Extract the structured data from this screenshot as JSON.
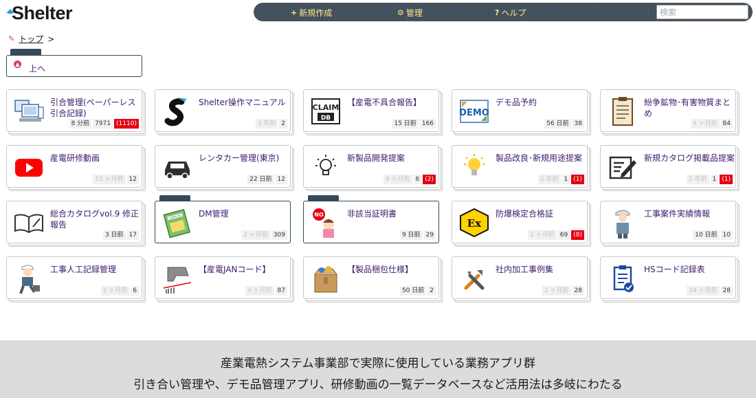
{
  "header": {
    "logo_text": "Shelter",
    "nav": [
      {
        "icon": "+",
        "label": "新規作成"
      },
      {
        "icon": "⚙",
        "label": "管理"
      },
      {
        "icon": "?",
        "label": "ヘルプ"
      }
    ],
    "search_placeholder": "検索"
  },
  "breadcrumb": {
    "home": "トップ",
    "separator": ">"
  },
  "up_folder": {
    "label": "上へ"
  },
  "cards": [
    {
      "title": "引合管理(ペーパーレス引合記録)",
      "time": "8 分前",
      "count": "7971",
      "badge": "(1110)",
      "icon": "computer-icon"
    },
    {
      "title": "Shelter操作マニュアル",
      "time": "3 年前",
      "count": "2",
      "icon": "shelter-logo-icon"
    },
    {
      "title": "【産電不具合報告】",
      "time": "15 日前",
      "count": "166",
      "icon": "claim-db-icon"
    },
    {
      "title": "デモ品予約",
      "time": "56 日前",
      "count": "38",
      "icon": "demo-icon"
    },
    {
      "title": "紛争鉱物･有害物質まとめ",
      "time": "4 ヶ月前",
      "count": "84",
      "icon": "clipboard-icon"
    },
    {
      "title": "産電研修動画",
      "time": "15 ヶ月前",
      "count": "12",
      "icon": "youtube-icon"
    },
    {
      "title": "レンタカー管理(東京)",
      "time": "22 日前",
      "count": "12",
      "icon": "car-icon"
    },
    {
      "title": "新製品開発提案",
      "time": "4 ヶ月前",
      "count": "6",
      "badge": "(2)",
      "icon": "lightbulb-outline-icon"
    },
    {
      "title": "製品改良･新規用途提案",
      "time": "2 年前",
      "count": "1",
      "badge": "(1)",
      "icon": "lightbulb-icon"
    },
    {
      "title": "新規カタログ掲載品提案",
      "time": "2 年前",
      "count": "1",
      "badge": "(1)",
      "icon": "edit-note-icon"
    },
    {
      "title": "総合カタログvol.9 修正報告",
      "time": "3 日前",
      "count": "17",
      "icon": "open-book-icon"
    },
    {
      "title": "DM管理",
      "time": "2 ヶ月前",
      "count": "309",
      "icon": "catalog-icon",
      "folder": true
    },
    {
      "title": "非該当証明書",
      "time": "9 日前",
      "count": "29",
      "icon": "no-person-icon",
      "folder": true
    },
    {
      "title": "防爆検定合格証",
      "time": "2 ヶ月前",
      "count": "69",
      "badge": "(8)",
      "icon": "ex-mark-icon"
    },
    {
      "title": "工事案件実績情報",
      "time": "10 日前",
      "count": "10",
      "icon": "worker-icon"
    },
    {
      "title": "工事人工記録管理",
      "time": "2 ヶ月前",
      "count": "6",
      "icon": "running-worker-icon"
    },
    {
      "title": "【産電JANコード】",
      "time": "4 ヶ月前",
      "count": "87",
      "icon": "barcode-scanner-icon"
    },
    {
      "title": "【製品梱包仕様】",
      "time": "50 日前",
      "count": "2",
      "icon": "package-icon"
    },
    {
      "title": "社内加工事例集",
      "time": "2 ヶ月前",
      "count": "28",
      "icon": "tools-icon"
    },
    {
      "title": "HSコード記録表",
      "time": "14 ヶ月前",
      "count": "28",
      "icon": "clipboard-check-icon"
    }
  ],
  "footer": {
    "line1": "産業電熱システム事業部で実際に使用している業務アプリ群",
    "line2": "引き合い管理や、デモ品管理アプリ、研修動画の一覧データベースなど活用法は多岐にわたる"
  },
  "colors": {
    "accent_dark": "#34495a",
    "badge_red": "#e60012",
    "nav_text": "#ffe98a",
    "title_text": "#3a1b6e"
  }
}
